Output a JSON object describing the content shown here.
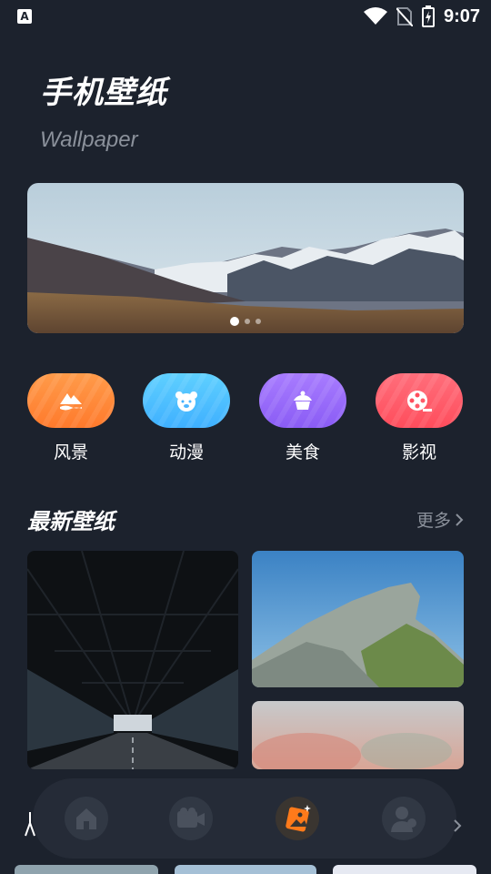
{
  "status_bar": {
    "time": "9:07",
    "app_icon_letter": "A"
  },
  "header": {
    "title": "手机壁纸",
    "subtitle": "Wallpaper"
  },
  "banner": {
    "page_count": 3,
    "active_index": 0
  },
  "categories": [
    {
      "label": "风景",
      "icon": "mountain-icon",
      "color": "#ff8a3d"
    },
    {
      "label": "动漫",
      "icon": "bear-icon",
      "color": "#4cc1ff"
    },
    {
      "label": "美食",
      "icon": "cake-icon",
      "color": "#9a6bff"
    },
    {
      "label": "影视",
      "icon": "film-reel-icon",
      "color": "#ff5c6a"
    }
  ],
  "latest": {
    "title": "最新壁纸",
    "more_label": "更多"
  },
  "bottom_nav": [
    {
      "icon": "home-icon",
      "active": false
    },
    {
      "icon": "video-icon",
      "active": false
    },
    {
      "icon": "wallpaper-icon",
      "active": true
    },
    {
      "icon": "user-icon",
      "active": false
    }
  ],
  "colors": {
    "background": "#1c222d",
    "active_nav": "#ff7a1a"
  }
}
